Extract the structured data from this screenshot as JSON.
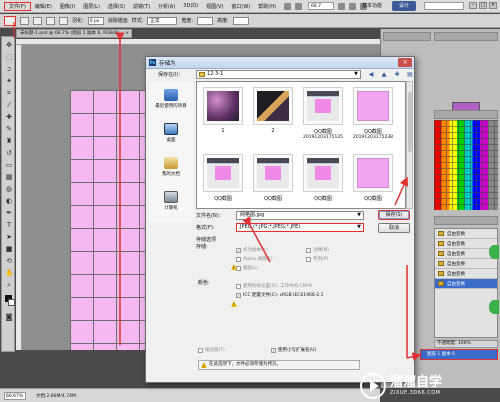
{
  "menubar": {
    "items": [
      "文件(F)",
      "编辑(E)",
      "图像(I)",
      "图层(L)",
      "选择(S)",
      "滤镜(T)",
      "分析(A)",
      "3D(D)",
      "视图(V)",
      "窗口(W)",
      "帮助(H)"
    ],
    "zoom": "66.7",
    "workspace_label": "基本功能",
    "active_workspace": "设计"
  },
  "optionsbar": {
    "feather_label": "羽化:",
    "feather_value": "0 px",
    "antialias_label": "消除锯齿",
    "style_label": "样式:",
    "style_value": "正常",
    "width_label": "宽度:",
    "height_label": "高度:"
  },
  "document": {
    "tab_title": "未标题-1.psd @ 66.7% (图层 1 副本 6, RGB/8)",
    "status_zoom": "66.67%",
    "status_doc": "文档:2.86M/4.74M"
  },
  "right_panels": {
    "layer_items": [
      "自由变换",
      "自由变换",
      "自由变换",
      "自由变换",
      "自由变换",
      "自由变换"
    ],
    "no_bg_label": "不透明度: 100%",
    "selected_layer": "图层 1 副本 6",
    "color_accent": "#b060c4"
  },
  "dialog": {
    "title": "存储为",
    "save_in_label": "保存在(I):",
    "save_in_value": "12-3-1",
    "places": [
      "最近使用的项目",
      "桌面",
      "我的文档",
      "计算机"
    ],
    "thumbnails": [
      {
        "label": "1",
        "kind": "photo1"
      },
      {
        "label": "2",
        "kind": "photo2"
      },
      {
        "label": "QQ截图",
        "sub": "20191203175135",
        "kind": "shot"
      },
      {
        "label": "QQ截图",
        "sub": "20191203175238",
        "kind": "pinksq"
      },
      {
        "label": "QQ截图",
        "sub": "",
        "kind": "shot"
      },
      {
        "label": "QQ截图",
        "sub": "",
        "kind": "shot"
      },
      {
        "label": "QQ截图",
        "sub": "",
        "kind": "shot"
      },
      {
        "label": "QQ截图",
        "sub": "",
        "kind": "pinksq"
      }
    ],
    "filename_label": "文件名(N):",
    "filename_value": "网格图.jpg",
    "format_label": "格式(F):",
    "format_value": "JPEG (*.JPG;*.JPEG;*.JPE)",
    "save_button": "保存(S)",
    "cancel_button": "取消",
    "storage_options_label": "存储选项",
    "storage_label": "存储:",
    "opt_copy": "作为副本(Y)",
    "opt_notes": "注释(N)",
    "opt_alpha": "Alpha 通道(E)",
    "opt_spot": "专色(P)",
    "opt_layers": "图层(L)",
    "color_label": "颜色:",
    "opt_proof": "使用校样设置(O): 工作中的 CMYK",
    "opt_icc": "ICC 配置文件(C): sRGB IEC61966-2.1",
    "opt_thumb": "缩览图(T)",
    "opt_lower": "使用小写扩展名(U)",
    "warning_text": "在此选项下，文件必须存储为拷贝。"
  },
  "watermark": {
    "title": "溜溜自学",
    "url": "ZIXUE.3D66.COM"
  }
}
